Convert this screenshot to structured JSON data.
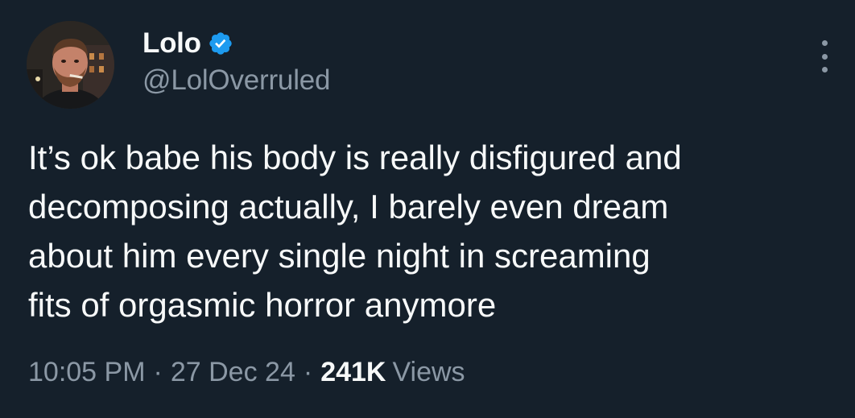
{
  "author": {
    "display_name": "Lolo",
    "handle": "@LolOverruled",
    "verified": true,
    "verified_color": "#1d9bf0"
  },
  "tweet": {
    "lines": [
      "It’s ok babe his body is really disfigured and",
      "decomposing actually, I barely even dream",
      "about him every single night in screaming",
      "fits of orgasmic horror anymore"
    ]
  },
  "meta": {
    "time": "10:05 PM",
    "separator": "·",
    "date": "27 Dec 24",
    "views_count": "241K",
    "views_label": "Views"
  },
  "icons": {
    "avatar": "profile-photo",
    "verified": "verified-badge-icon",
    "more": "more-options-icon"
  },
  "colors": {
    "background": "#15202b",
    "primary_text": "#f7f9f9",
    "secondary_text": "#8b98a5"
  }
}
